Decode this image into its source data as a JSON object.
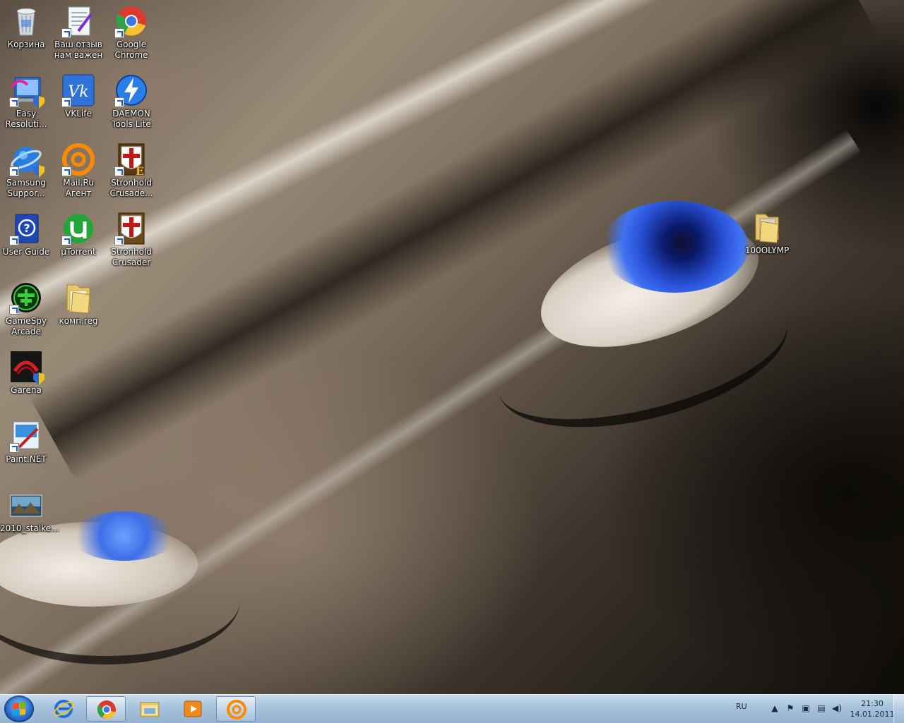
{
  "desktop": {
    "icons": [
      {
        "id": "recycle-bin",
        "label": "Корзина"
      },
      {
        "id": "feedback",
        "label": "Ваш отзыв нам важен"
      },
      {
        "id": "google-chrome",
        "label": "Google Chrome"
      },
      {
        "id": "easy-resolution",
        "label": "Easy Resoluti..."
      },
      {
        "id": "vklife",
        "label": "VKLife"
      },
      {
        "id": "daemon-tools",
        "label": "DAEMON Tools Lite"
      },
      {
        "id": "samsung-support",
        "label": "Samsung Suppor..."
      },
      {
        "id": "mailru-agent",
        "label": "Mail.Ru Агент"
      },
      {
        "id": "stronghold-crusader-extreme",
        "label": "Stronhold Crusade..."
      },
      {
        "id": "user-guide",
        "label": "User Guide"
      },
      {
        "id": "utorrent",
        "label": "µTorrent"
      },
      {
        "id": "stronghold-crusader",
        "label": "Stronhold Crusader"
      },
      {
        "id": "gamespy-arcade",
        "label": "GameSpy Arcade"
      },
      {
        "id": "komp-reg",
        "label": "комп.reg"
      },
      {
        "id": "garena",
        "label": "Garena"
      },
      {
        "id": "paintnet",
        "label": "Paint.NET"
      },
      {
        "id": "stalker-image",
        "label": "2010_stalke..."
      },
      {
        "id": "100olymp",
        "label": "100OLYMP"
      }
    ]
  },
  "taskbar": {
    "pinned": [
      {
        "name": "internet-explorer",
        "active": false
      },
      {
        "name": "google-chrome",
        "active": true
      },
      {
        "name": "windows-explorer",
        "active": false
      },
      {
        "name": "media-player",
        "active": false
      },
      {
        "name": "mailru-agent",
        "active": true
      }
    ],
    "tray": {
      "language": "RU",
      "time": "21:30",
      "date": "14.01.2011"
    }
  },
  "colors": {
    "taskbar": "#a6c1dc",
    "start_orb": "#2a6ed0",
    "label_text": "#ffffff"
  }
}
